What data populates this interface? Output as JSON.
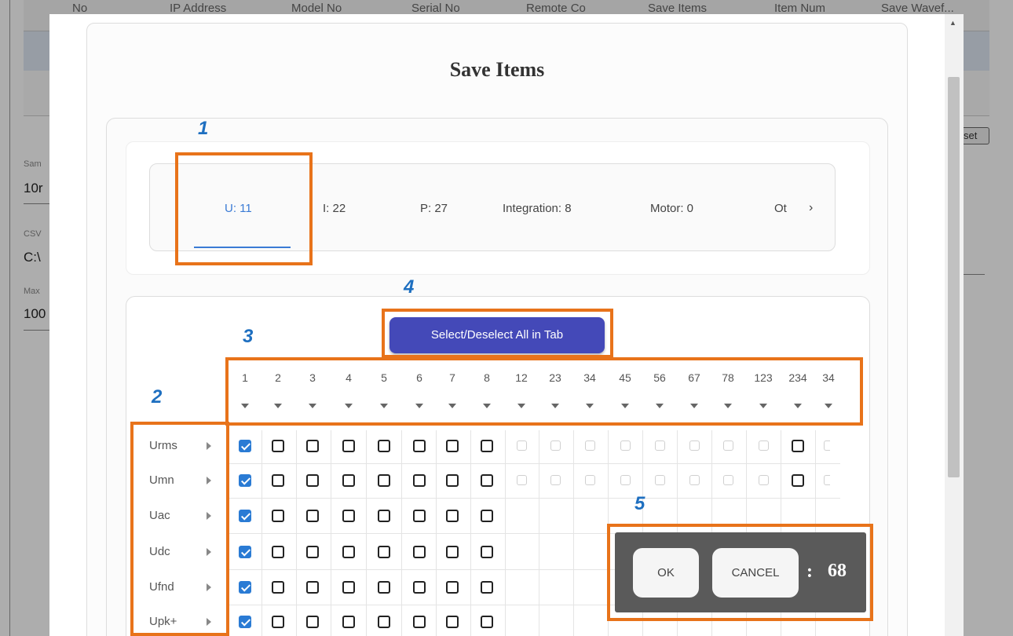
{
  "background": {
    "columns": [
      "No",
      "IP Address",
      "Model No",
      "Serial No",
      "Remote Co",
      "Save Items",
      "Item Num",
      "Save Wavef..."
    ],
    "fields": [
      {
        "label": "Sam",
        "value": "10r"
      },
      {
        "label": "CSV",
        "value": "C:\\"
      },
      {
        "label": "Max",
        "value": "100"
      }
    ],
    "reset_label": "set"
  },
  "dialog": {
    "title": "Save Items",
    "tabs": [
      {
        "label": "U: 11",
        "active": true
      },
      {
        "label": "I: 22",
        "active": false
      },
      {
        "label": "P: 27",
        "active": false
      },
      {
        "label": "Integration: 8",
        "active": false
      },
      {
        "label": "Motor: 0",
        "active": false
      },
      {
        "label": "Ot",
        "active": false
      }
    ],
    "tab_next_icon": "›",
    "select_all_label": "Select/Deselect All in Tab",
    "columns": [
      "1",
      "2",
      "3",
      "4",
      "5",
      "6",
      "7",
      "8",
      "12",
      "23",
      "34",
      "45",
      "56",
      "67",
      "78",
      "123",
      "234",
      "34"
    ],
    "rows": [
      {
        "label": "Urms",
        "checked": [
          true,
          false,
          false,
          false,
          false,
          false,
          false,
          false
        ],
        "dim_count": 8,
        "extra": true
      },
      {
        "label": "Umn",
        "checked": [
          true,
          false,
          false,
          false,
          false,
          false,
          false,
          false
        ],
        "dim_count": 8,
        "extra": true
      },
      {
        "label": "Uac",
        "checked": [
          true,
          false,
          false,
          false,
          false,
          false,
          false,
          false
        ],
        "dim_count": 0,
        "extra": false
      },
      {
        "label": "Udc",
        "checked": [
          true,
          false,
          false,
          false,
          false,
          false,
          false,
          false
        ],
        "dim_count": 0,
        "extra": false
      },
      {
        "label": "Ufnd",
        "checked": [
          true,
          false,
          false,
          false,
          false,
          false,
          false,
          false
        ],
        "dim_count": 0,
        "extra": false
      },
      {
        "label": "Upk+",
        "checked": [
          true,
          false,
          false,
          false,
          false,
          false,
          false,
          false
        ],
        "dim_count": 0,
        "extra": false
      }
    ],
    "ok_label": "OK",
    "cancel_label": "CANCEL",
    "count_colon": ":",
    "count_value": "68"
  },
  "annotations": [
    "1",
    "2",
    "3",
    "4",
    "5"
  ],
  "colors": {
    "highlight": "#e8731a",
    "annotation": "#1e6fc0",
    "button": "#4449b8",
    "active_tab": "#3a7bd5"
  }
}
